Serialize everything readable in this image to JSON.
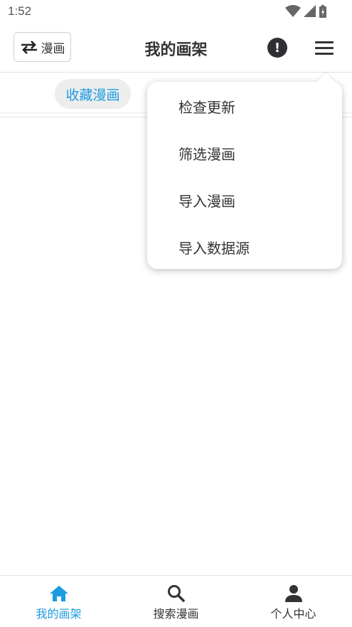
{
  "status_bar": {
    "time": "1:52"
  },
  "toolbar": {
    "switch_label": "漫画",
    "title": "我的画架"
  },
  "tabs": [
    {
      "label": "收藏漫画"
    }
  ],
  "menu": {
    "items": [
      {
        "label": "检查更新"
      },
      {
        "label": "筛选漫画"
      },
      {
        "label": "导入漫画"
      },
      {
        "label": "导入数据源"
      }
    ]
  },
  "bottom_nav": {
    "items": [
      {
        "label": "我的画架",
        "icon": "home-icon",
        "active": true
      },
      {
        "label": "搜索漫画",
        "icon": "search-icon",
        "active": false
      },
      {
        "label": "个人中心",
        "icon": "person-icon",
        "active": false
      }
    ]
  },
  "colors": {
    "accent": "#1c9be0",
    "text": "#333333"
  }
}
